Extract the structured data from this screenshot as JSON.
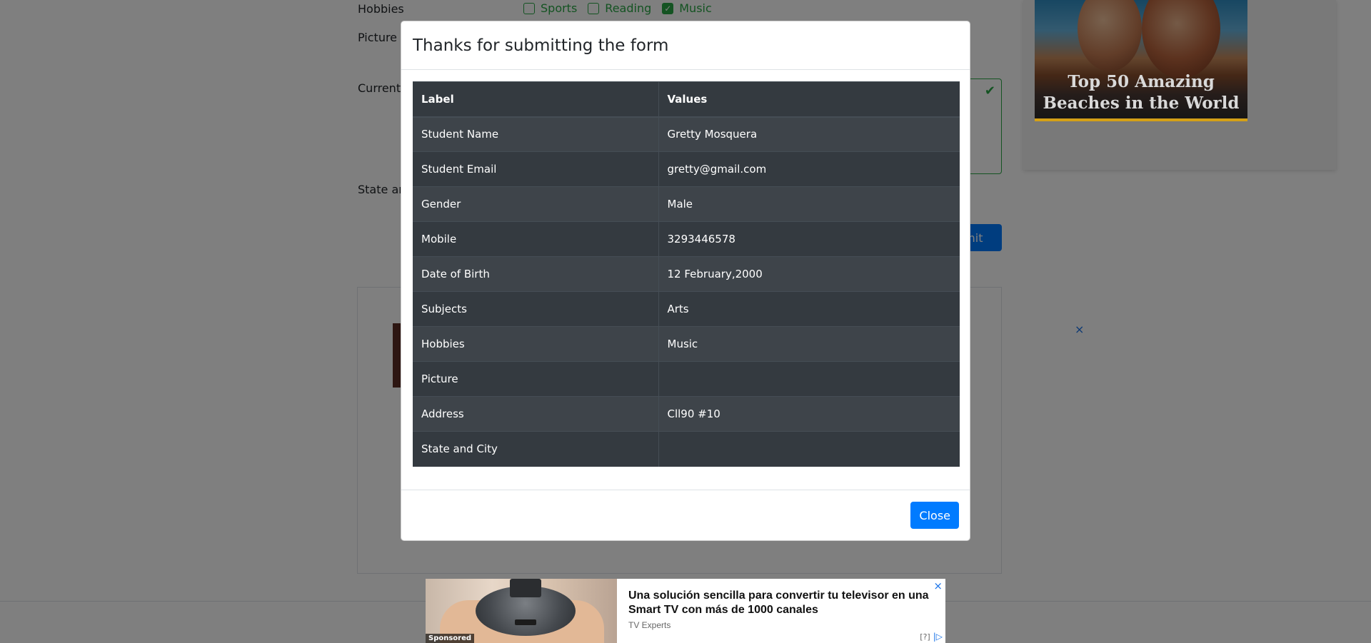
{
  "background": {
    "labels": {
      "hobbies": "Hobbies",
      "picture": "Picture",
      "current_address": "Current A",
      "state_city": "State and"
    },
    "hobbies_options": [
      {
        "label": "Sports",
        "checked": false
      },
      {
        "label": "Reading",
        "checked": false
      },
      {
        "label": "Music",
        "checked": true
      }
    ],
    "submit_label": "bmit",
    "side_ad": {
      "title": "Top 50 Amazing Beaches in the World"
    },
    "ad_close": "×",
    "valid_icon": "check-icon"
  },
  "modal": {
    "title": "Thanks for submitting the form",
    "table": {
      "headers": [
        "Label",
        "Values"
      ],
      "rows": [
        {
          "label": "Student Name",
          "value": "Gretty Mosquera"
        },
        {
          "label": "Student Email",
          "value": "gretty@gmail.com"
        },
        {
          "label": "Gender",
          "value": "Male"
        },
        {
          "label": "Mobile",
          "value": "3293446578"
        },
        {
          "label": "Date of Birth",
          "value": "12 February,2000"
        },
        {
          "label": "Subjects",
          "value": "Arts"
        },
        {
          "label": "Hobbies",
          "value": "Music"
        },
        {
          "label": "Picture",
          "value": ""
        },
        {
          "label": "Address",
          "value": "Cll90 #10"
        },
        {
          "label": "State and City",
          "value": ""
        }
      ]
    },
    "close_label": "Close"
  },
  "bottom_ad": {
    "headline": "Una solución sencilla para convertir tu televisor en una Smart TV con más de 1000 canales",
    "source": "TV Experts",
    "sponsored": "Sponsored",
    "info": "[?]",
    "close": "×"
  },
  "colors": {
    "primary": "#007bff",
    "success": "#28a745",
    "table_dark": "#343a40",
    "table_dark_stripe": "#3e444a"
  }
}
